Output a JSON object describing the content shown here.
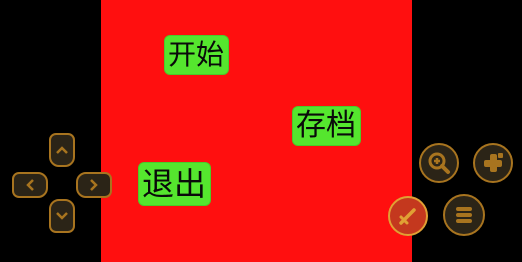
{
  "menu": {
    "start_label": "开始",
    "save_label": "存档",
    "exit_label": "退出"
  },
  "controls": {
    "dpad": [
      "chevron-up-icon",
      "chevron-down-icon",
      "chevron-left-icon",
      "chevron-right-icon"
    ],
    "buttons": [
      "zoom-in-icon",
      "plus-icon",
      "sword-icon",
      "menu-icon"
    ]
  },
  "colors": {
    "screen": "#ff0f0f",
    "menu_item": "#55e62e",
    "control_fill": "#2b2417",
    "control_border": "#a8741f",
    "attack_button": "#c4381e"
  }
}
